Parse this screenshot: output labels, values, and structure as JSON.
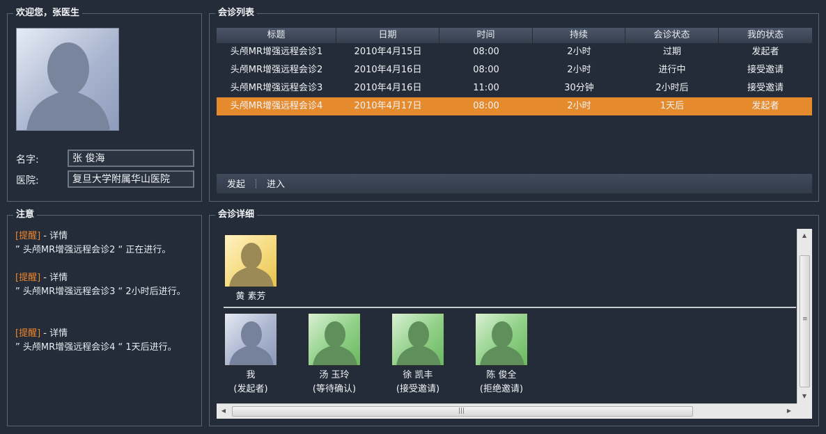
{
  "welcome": {
    "title": "欢迎您，张医生",
    "name_label": "名字:",
    "name_value": "张 俊海",
    "hospital_label": "医院:",
    "hospital_value": "复旦大学附属华山医院"
  },
  "list": {
    "title": "会诊列表",
    "columns": [
      "标题",
      "日期",
      "时间",
      "持续",
      "会诊状态",
      "我的状态"
    ],
    "rows": [
      [
        "头颅MR增强远程会诊1",
        "2010年4月15日",
        "08:00",
        "2小时",
        "过期",
        "发起者"
      ],
      [
        "头颅MR增强远程会诊2",
        "2010年4月16日",
        "08:00",
        "2小时",
        "进行中",
        "接受邀请"
      ],
      [
        "头颅MR增强远程会诊3",
        "2010年4月16日",
        "11:00",
        "30分钟",
        "2小时后",
        "接受邀请"
      ],
      [
        "头颅MR增强远程会诊4",
        "2010年4月17日",
        "08:00",
        "2小时",
        "1天后",
        "发起者"
      ]
    ],
    "selected_row": 3,
    "toolbar": {
      "launch_label": "发起",
      "enter_label": "进入"
    }
  },
  "notice": {
    "title": "注意",
    "items": [
      {
        "tag": "[提醒]",
        "detail": " - 详情",
        "text": "” 头颅MR增强远程会诊2 “ 正在进行。"
      },
      {
        "tag": "[提醒]",
        "detail": " - 详情",
        "text": "” 头颅MR增强远程会诊3 “ 2小时后进行。"
      },
      {
        "tag": "[提醒]",
        "detail": " - 详情",
        "text": "” 头颅MR增强远程会诊4 “ 1天后进行。"
      }
    ]
  },
  "detail": {
    "title": "会诊详细",
    "host": {
      "name": "黄 素芳"
    },
    "participants": [
      {
        "name": "我",
        "status": "(发起者)"
      },
      {
        "name": "汤 玉玲",
        "status": "(等待确认)"
      },
      {
        "name": "徐 凯丰",
        "status": "(接受邀请)"
      },
      {
        "name": "陈 俊全",
        "status": "(拒绝邀请)"
      }
    ]
  },
  "colors": {
    "background": "#232c38",
    "selected_row": "#e68a2e",
    "tag": "#f0862c"
  },
  "icons": [
    "avatar-silhouette-icon",
    "scroll-up-icon",
    "scroll-down-icon",
    "scroll-left-icon",
    "scroll-right-icon"
  ]
}
